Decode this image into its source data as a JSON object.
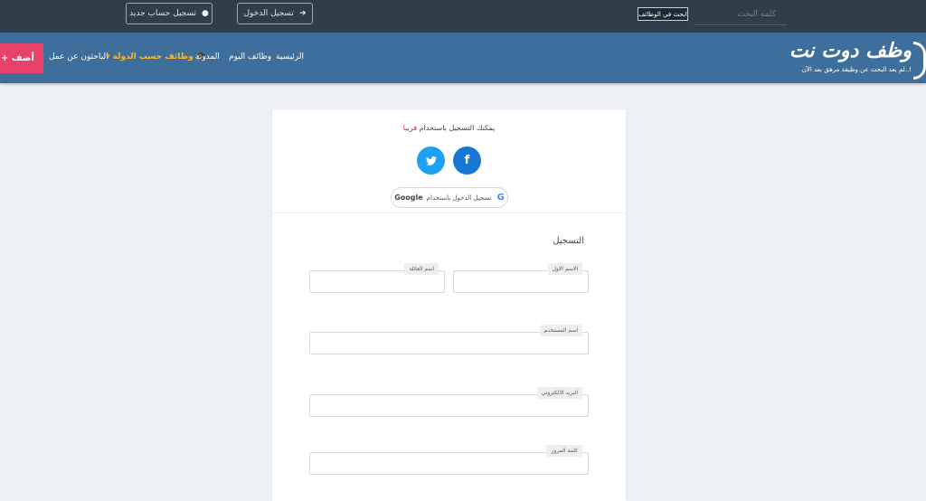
{
  "topbar": {
    "register_label": "تسجيل حساب جديد",
    "login_label": "تسجيل الدخول",
    "search_jobs_label": "ابحث في الوظائف",
    "search_placeholder": "كلمة البحث"
  },
  "nav": {
    "add_label": "+ أضف",
    "items": [
      {
        "label": "الباحثون عن عمل"
      },
      {
        "label": "▾ وظائف حسب الدولة 🎓"
      },
      {
        "label": "المدونة"
      },
      {
        "label": "وظائف اليوم"
      },
      {
        "label": "الرئيسية"
      }
    ]
  },
  "logo": {
    "title": "وظف دوت نت",
    "tagline": "لم يعد البحث عن وظيفة مرهق بعد الآن..!"
  },
  "social": {
    "text": "يمكنك التسجيل باستخدام",
    "soon": "قريبا",
    "google_label": "تسجيل الدخول باستخدام",
    "google_word": "Google"
  },
  "form": {
    "title": "التسجيل",
    "first_name": "الاسم الاول",
    "last_name": "اسم العائلة",
    "username": "اسم المستخدم",
    "email": "البريد الالكتروني",
    "password": "كلمة المرور"
  },
  "colors": {
    "topbar": "#2f3e4a",
    "navbar": "#3e6f9c",
    "accent": "#e9426a",
    "nav_highlight": "#f7b733",
    "twitter": "#1da1f2",
    "facebook": "#1877d2"
  },
  "icons": {
    "register": "user-icon",
    "login": "sign-in-icon",
    "twitter": "twitter-icon",
    "facebook": "facebook-icon",
    "google": "google-icon",
    "graduation": "graduation-cap-icon"
  }
}
